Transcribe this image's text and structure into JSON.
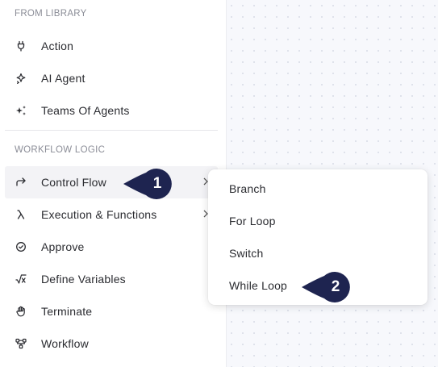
{
  "sidebar": {
    "library_title": "FROM LIBRARY",
    "library_items": [
      {
        "label": "Action",
        "icon": "plug-icon"
      },
      {
        "label": "AI Agent",
        "icon": "sparkle-icon"
      },
      {
        "label": "Teams Of Agents",
        "icon": "sparkles-icon"
      }
    ],
    "logic_title": "WORKFLOW LOGIC",
    "logic_items": [
      {
        "label": "Control Flow",
        "icon": "redirect-arrow-icon",
        "has_submenu": true
      },
      {
        "label": "Execution & Functions",
        "icon": "lambda-icon",
        "has_submenu": true
      },
      {
        "label": "Approve",
        "icon": "check-circle-icon"
      },
      {
        "label": "Define Variables",
        "icon": "sqrt-x-icon"
      },
      {
        "label": "Terminate",
        "icon": "hand-icon"
      },
      {
        "label": "Workflow",
        "icon": "workflow-nodes-icon"
      }
    ]
  },
  "submenu": {
    "items": [
      {
        "label": "Branch"
      },
      {
        "label": "For Loop"
      },
      {
        "label": "Switch"
      },
      {
        "label": "While Loop"
      }
    ]
  },
  "markers": [
    {
      "number": "1"
    },
    {
      "number": "2"
    }
  ],
  "colors": {
    "marker": "#1e2450",
    "text": "#2a2b30",
    "section_title": "#8b8d97",
    "canvas_bg": "#f7f8fc",
    "active_bg": "#f3f3f6"
  }
}
